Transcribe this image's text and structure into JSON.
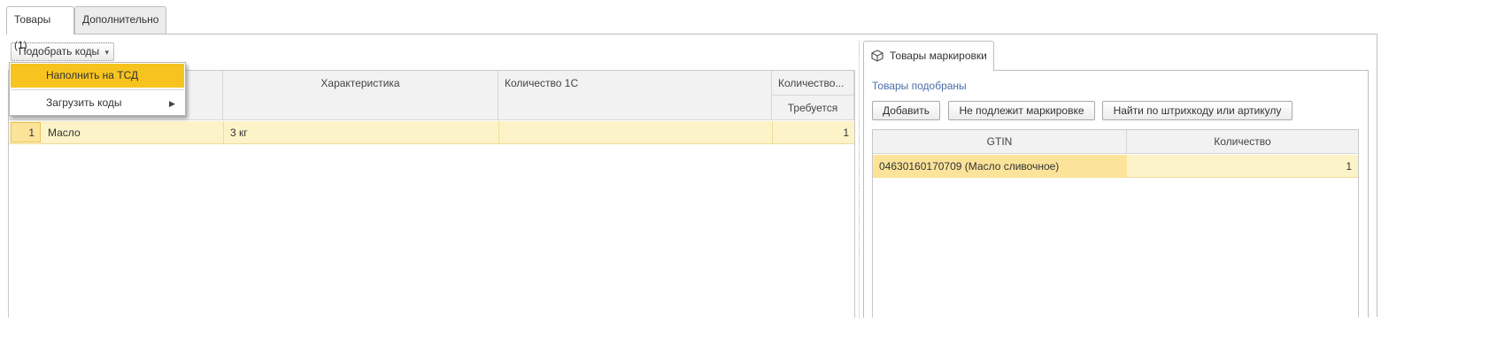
{
  "tabs": [
    {
      "label": "Товары (1)",
      "active": true
    },
    {
      "label": "Дополнительно",
      "active": false
    }
  ],
  "left": {
    "select_codes_button": "Подобрать коды",
    "dropdown_arrow": "▾",
    "menu": [
      {
        "label": "Наполнить на ТСД",
        "highlighted": true
      },
      {
        "label": "Загрузить коды",
        "has_submenu": true,
        "arrow": "▶"
      }
    ],
    "table": {
      "headers": {
        "characteristic": "Характеристика",
        "qty_1c": "Количество 1С",
        "qty_group": "Количество...",
        "required": "Требуется"
      },
      "rows": [
        {
          "n": "1",
          "name": "Масло",
          "characteristic": "3 кг",
          "qty_1c": "",
          "required": "1"
        }
      ]
    }
  },
  "right": {
    "tab_label": "Товары маркировки",
    "tab_icon": "box-icon",
    "status_text": "Товары подобраны",
    "buttons": {
      "add": "Добавить",
      "not_marked": "Не подлежит маркировке",
      "find": "Найти по штрихкоду или артикулу"
    },
    "table": {
      "headers": {
        "gtin": "GTIN",
        "qty": "Количество"
      },
      "rows": [
        {
          "gtin": "04630160170709 (Масло сливочное)",
          "qty": "1"
        }
      ]
    }
  },
  "colors": {
    "accent_highlight": "#f7c41f",
    "selected_row": "#fdf3c8",
    "selected_cell": "#fbe39a",
    "link_blue": "#4a6ea8"
  }
}
